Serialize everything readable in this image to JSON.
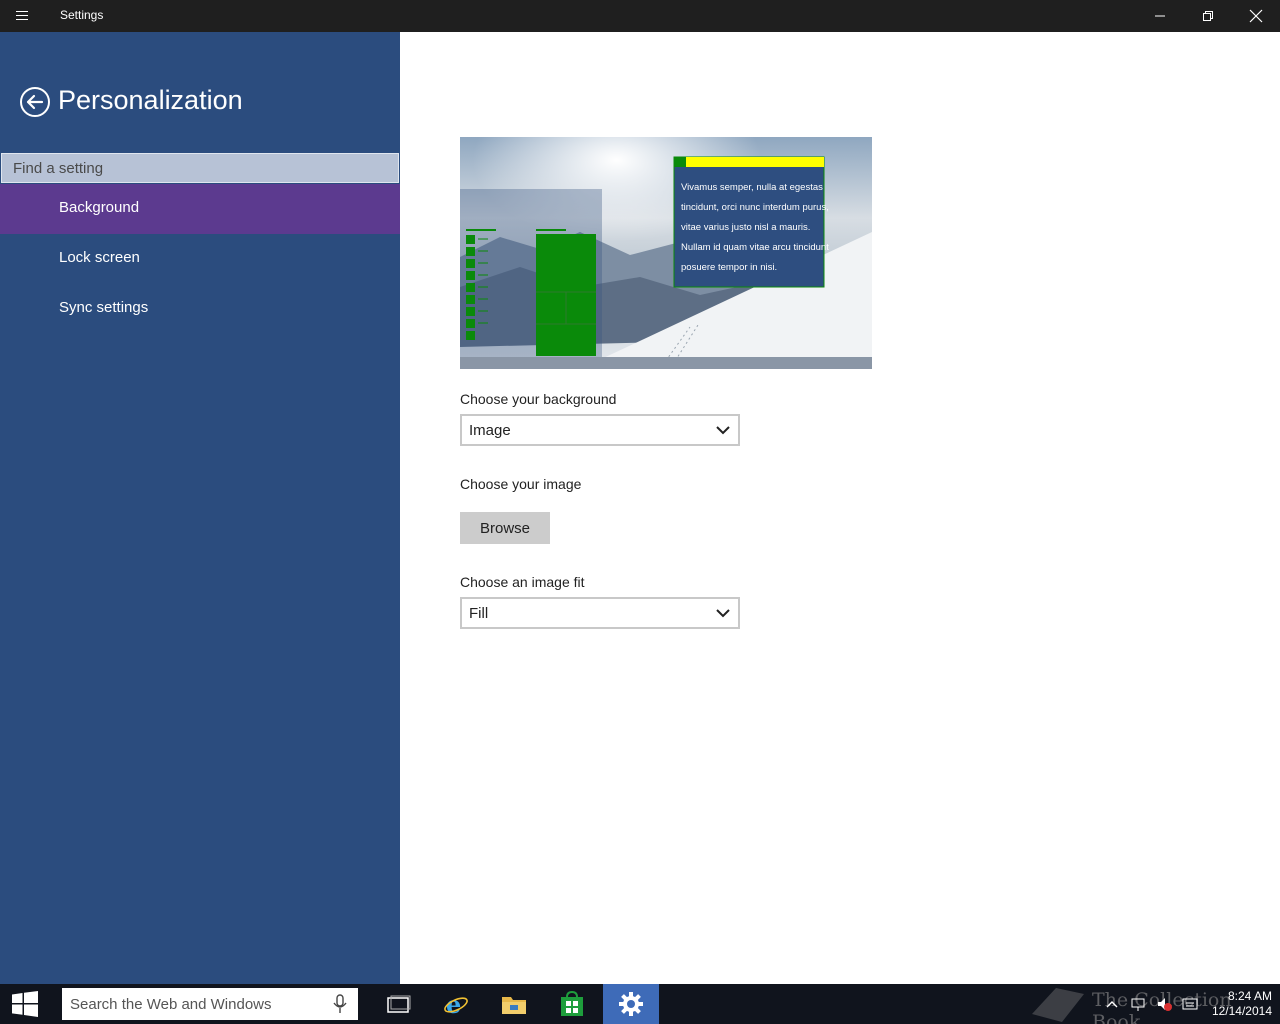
{
  "window": {
    "title": "Settings",
    "controls": [
      "minimize",
      "restore",
      "close"
    ]
  },
  "sidebar": {
    "page_title": "Personalization",
    "search_placeholder": "Find a setting",
    "items": [
      {
        "label": "Background",
        "active": true
      },
      {
        "label": "Lock screen",
        "active": false
      },
      {
        "label": "Sync settings",
        "active": false
      }
    ],
    "colors": {
      "background": "#2b4c7e",
      "active": "#5c3a8f"
    }
  },
  "main": {
    "preview": {
      "sample_text": "Vivamus semper, nulla at egestas tincidunt, orci nunc interdum purus, vitae varius justo nisl a mauris. Nullam id quam vitae arcu tincidunt posuere tempor in nisi.",
      "accent_color": "#0a8a0a",
      "title_bar_color": "#ffff00"
    },
    "background_label": "Choose your background",
    "background_value": "Image",
    "image_label": "Choose your image",
    "browse_label": "Browse",
    "fit_label": "Choose an image fit",
    "fit_value": "Fill"
  },
  "taskbar": {
    "search_placeholder": "Search the Web and Windows",
    "apps": [
      "task-view-icon",
      "internet-explorer-icon",
      "file-explorer-icon",
      "store-icon",
      "settings-icon"
    ],
    "active_app": "settings-icon",
    "watermark": "The Collection Book",
    "time": "8:24 AM",
    "date": "12/14/2014"
  }
}
